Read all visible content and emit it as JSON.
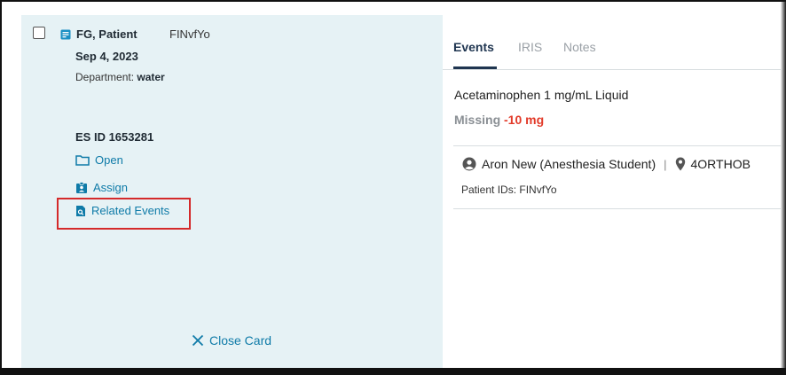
{
  "card": {
    "patient_name": "FG, Patient",
    "patient_fin": "FINvfYo",
    "date": "Sep 4, 2023",
    "department_label": "Department:",
    "department_value": "water",
    "es_id": "ES ID 1653281",
    "actions": {
      "open": "Open",
      "assign": "Assign",
      "related_events": "Related Events"
    },
    "close_label": "Close Card"
  },
  "tabs": [
    {
      "label": "Events",
      "active": true
    },
    {
      "label": "IRIS",
      "active": false
    },
    {
      "label": "Notes",
      "active": false
    }
  ],
  "event": {
    "medication": "Acetaminophen 1 mg/mL Liquid",
    "status_label": "Missing",
    "status_value": "-10 mg",
    "user": "Aron New (Anesthesia Student)",
    "location": "4ORTHOB",
    "patient_ids": "Patient IDs: FINvfYo"
  },
  "colors": {
    "card_bg": "#e6f2f5",
    "link": "#0f7ba8",
    "active_tab": "#1f3550",
    "missing_value": "#e23b2a",
    "highlight": "#d42a2a"
  },
  "icons": [
    "checkbox-icon",
    "note-icon",
    "folder-icon",
    "assign-icon",
    "related-events-icon",
    "close-icon",
    "user-icon",
    "location-pin-icon"
  ]
}
